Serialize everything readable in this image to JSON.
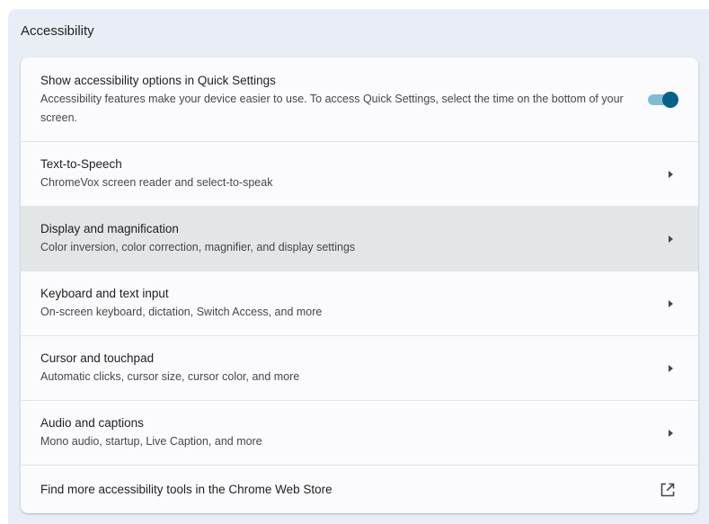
{
  "section": {
    "title": "Accessibility"
  },
  "quick_settings": {
    "title": "Show accessibility options in Quick Settings",
    "description": "Accessibility features make your device easier to use. To access Quick Settings, select the time on the bottom of your screen.",
    "toggle_on": true
  },
  "items": [
    {
      "title": "Text-to-Speech",
      "description": "ChromeVox screen reader and select-to-speak"
    },
    {
      "title": "Display and magnification",
      "description": "Color inversion, color correction, magnifier, and display settings"
    },
    {
      "title": "Keyboard and text input",
      "description": "On-screen keyboard, dictation, Switch Access, and more"
    },
    {
      "title": "Cursor and touchpad",
      "description": "Automatic clicks, cursor size, cursor color, and more"
    },
    {
      "title": "Audio and captions",
      "description": "Mono audio, startup, Live Caption, and more"
    }
  ],
  "store_link": {
    "title": "Find more accessibility tools in the Chrome Web Store",
    "icon": "open-in-new-icon"
  },
  "colors": {
    "accent": "#04628a",
    "toggle_track": "#7fbcd4",
    "hover_row": "#e2e6e6",
    "page_background": "#e9eef6"
  }
}
